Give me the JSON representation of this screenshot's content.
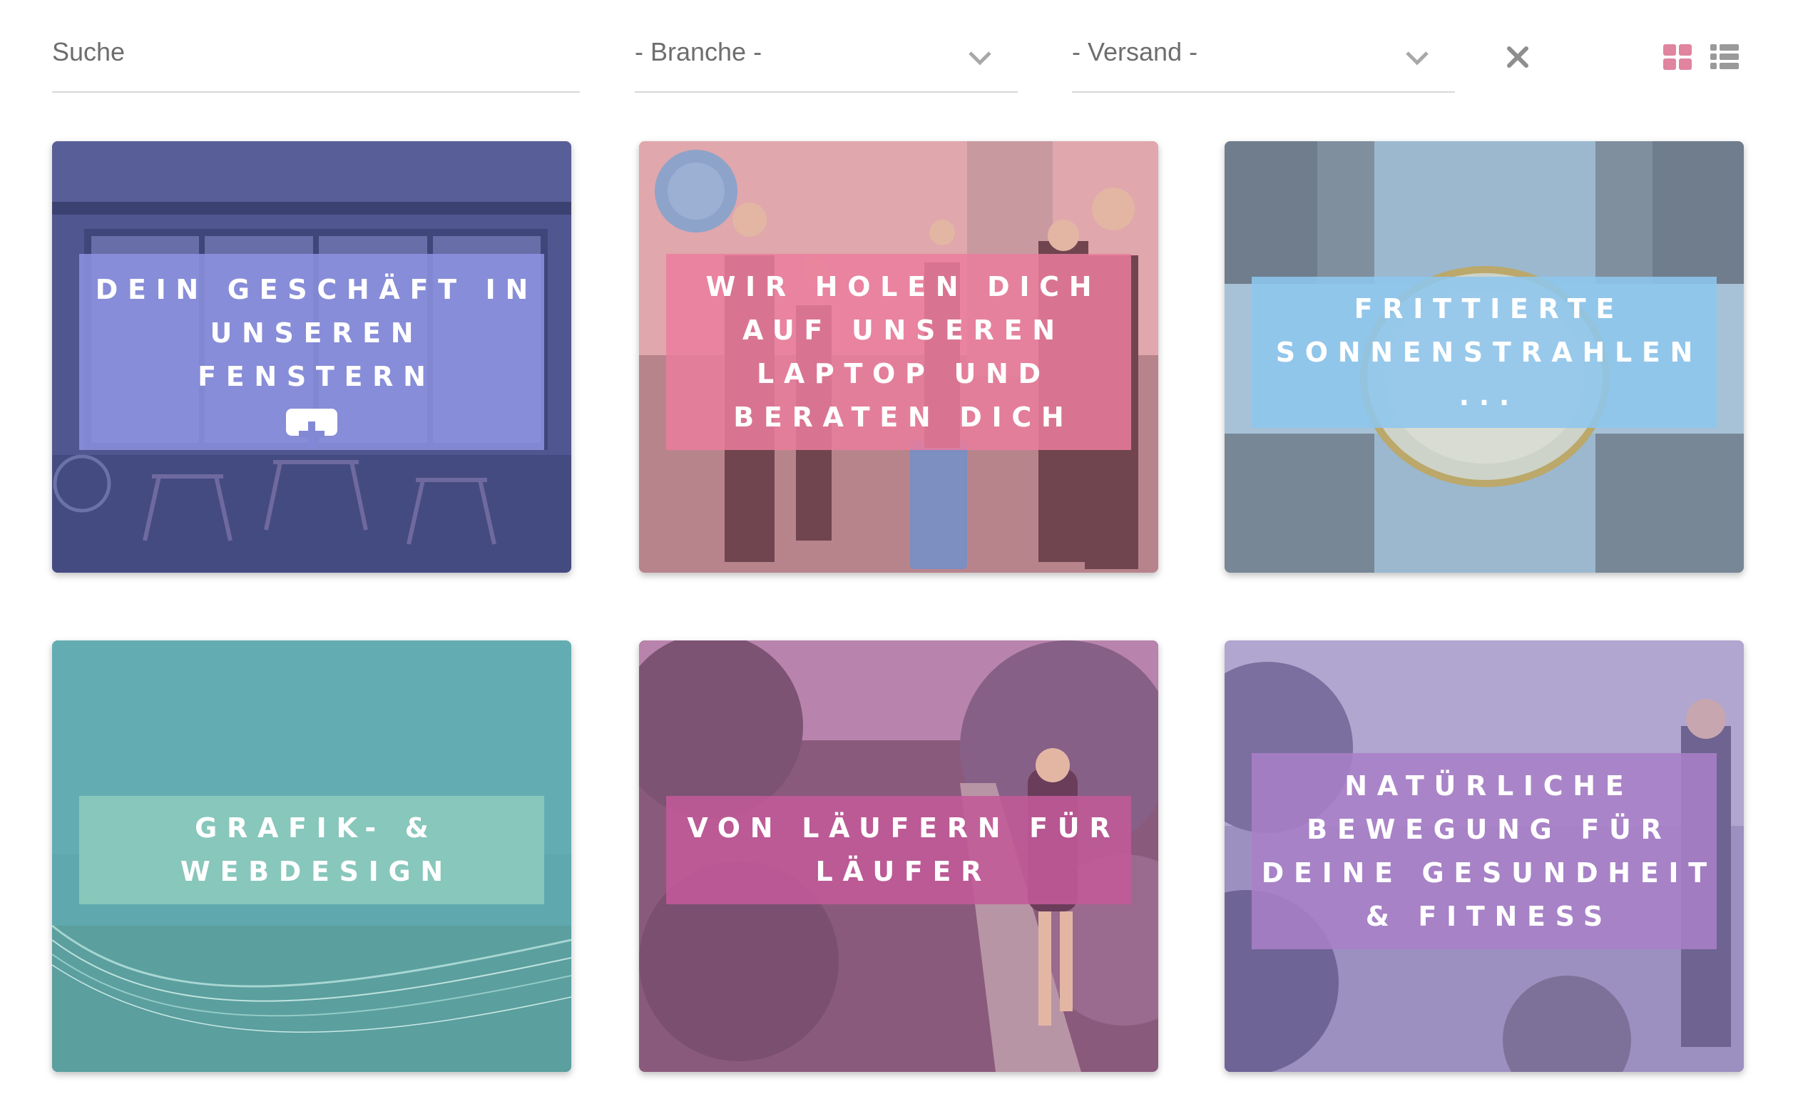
{
  "filters": {
    "search_placeholder": "Suche",
    "branche_label": "- Branche -",
    "versand_label": "- Versand -"
  },
  "icons": {
    "branche_dropdown": "chevron-down-icon",
    "versand_dropdown": "chevron-down-icon",
    "clear": "close-icon",
    "grid_view": "grid-view-icon",
    "list_view": "list-view-icon",
    "add": "plus-icon"
  },
  "colors": {
    "active_view": "#e0849f",
    "inactive_view": "#9a9a9a",
    "card_1_overlay": "#8d93e0",
    "card_2_overlay": "#ea7d9c",
    "card_3_overlay": "#8ec6ee",
    "card_4_overlay": "#8ac8bc",
    "card_5_overlay": "#c15a98",
    "card_6_overlay": "#a97fc7"
  },
  "cards": [
    {
      "title": "DEIN GESCHÄFT IN UNSEREN FENSTERN"
    },
    {
      "title": "WIR HOLEN DICH AUF UNSEREN LAPTOP UND BERATEN DICH"
    },
    {
      "title": "FRITTIERTE SONNENSTRAHLEN ..."
    },
    {
      "title": "GRAFIK- & WEBDESIGN"
    },
    {
      "title": "VON LÄUFERN FÜR LÄUFER"
    },
    {
      "title": "NATÜRLICHE BEWEGUNG FÜR DEINE GESUNDHEIT & FITNESS"
    }
  ]
}
